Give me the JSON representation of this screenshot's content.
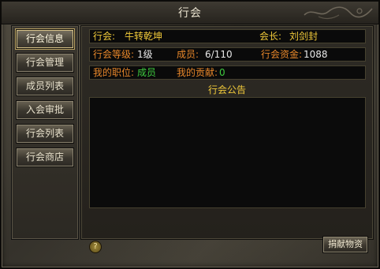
{
  "window": {
    "title": "行会"
  },
  "sidebar": {
    "items": [
      {
        "label": "行会信息",
        "active": true
      },
      {
        "label": "行会管理"
      },
      {
        "label": "成员列表"
      },
      {
        "label": "入会审批"
      },
      {
        "label": "行会列表"
      },
      {
        "label": "行会商店"
      }
    ]
  },
  "guild": {
    "name_label": "行会:",
    "name": "牛转乾坤",
    "leader_label": "会长:",
    "leader": "刘剑封",
    "level_label": "行会等级:",
    "level": "1级",
    "members_label": "成员:",
    "members": "6/110",
    "funds_label": "行会资金:",
    "funds": "1088",
    "position_label": "我的职位:",
    "position": "成员",
    "contribution_label": "我的贡献:",
    "contribution": "0"
  },
  "notice": {
    "title": "行会公告",
    "text": ""
  },
  "footer": {
    "help_icon": "?",
    "donate_label": "捐献物资"
  },
  "colors": {
    "label_yellow": "#f0c93a",
    "label_orange": "#e6862a",
    "value_green": "#3fcb3f",
    "active_border": "#d8c48a"
  }
}
